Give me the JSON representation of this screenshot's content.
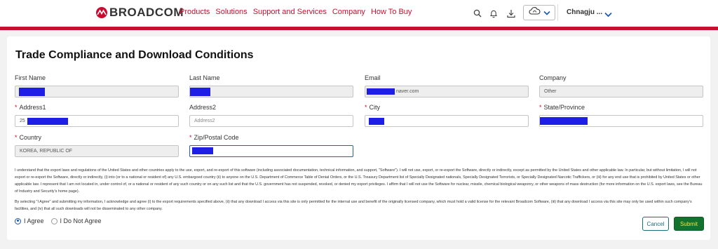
{
  "header": {
    "brand": "BROADCOM",
    "nav": [
      "Products",
      "Solutions",
      "Support and Services",
      "Company",
      "How To Buy"
    ],
    "icons": [
      "search-icon",
      "bell-icon",
      "download-icon",
      "cloud-icon",
      "user-menu-chevron-icon"
    ],
    "user_name": "Chnagju ...",
    "colors": {
      "brand_red": "#c8102e"
    }
  },
  "form": {
    "title": "Trade Compliance and Download Conditions",
    "fields": {
      "first_name": {
        "label": "First Name",
        "value": "",
        "required": false
      },
      "last_name": {
        "label": "Last Name",
        "value": "",
        "required": false
      },
      "email": {
        "label": "Email",
        "value": "naver.com",
        "required": false
      },
      "company": {
        "label": "Company",
        "value": "Other",
        "required": false
      },
      "address1": {
        "label": "Address1",
        "value": "25",
        "required": true
      },
      "address2": {
        "label": "Address2",
        "placeholder": "Address2",
        "required": false
      },
      "city": {
        "label": "City",
        "value": "",
        "required": true
      },
      "state": {
        "label": "State/Province",
        "value": "",
        "required": true
      },
      "country": {
        "label": "Country",
        "value": "KOREA, REPUBLIC OF",
        "required": true
      },
      "zip": {
        "label": "Zip/Postal Code",
        "value": "",
        "required": true
      }
    },
    "legal_paragraph_1": "I understand that the export laws and regulations of the United States and other countries apply to the use, export, and re-export of this software (including associated documentation, technical information, and support, \"Software\"). I will not use, export, or re-export the Software, directly or indirectly, except as permitted by the United States and other applicable law. In particular, but without limitation, I will not export or re-export the Software, directly or indirectly, (i) into (or to a national or resident of) any U.S. embargoed country (ii) to anyone on the U.S. Department of Commerce Table of Denial Orders, or the U.S. Treasury Department list of Specially Designated nationals, Specially Designated Terrorists, or Specially Designated Narcotic Traffickers, or (iii) for any end use that is prohibited by United States or other applicable law. I represent that I am not located in, under control of, or a national or resident of any such country or on any such list and that the U.S. government has not suspended, revoked, or denied my export privileges. I affirm that I will not use the Software for nuclear, missile, chemical biological weaponry, or other weapons of mass destruction (for more information on the U.S. export laws, see the Bureau of Industry and Security's home page).",
    "legal_paragraph_2": "By selecting \"I Agree\" and submitting my information, I acknowledge and agree (i) to the export requirements specified above, (ii) that any download I access via this site is only permitted for the internal use and benefit of the originally licensed company, which must hold a valid license for the relevant Broadcom Software, (iii) that any download I access via this site may only be used within such company's facilities, and (iv) that all such downloads will not be disseminated to any other company.",
    "agree_label": "I Agree",
    "disagree_label": "I Do Not Agree",
    "selected_option": "I Agree",
    "cancel_label": "Cancel",
    "submit_label": "Submit"
  }
}
